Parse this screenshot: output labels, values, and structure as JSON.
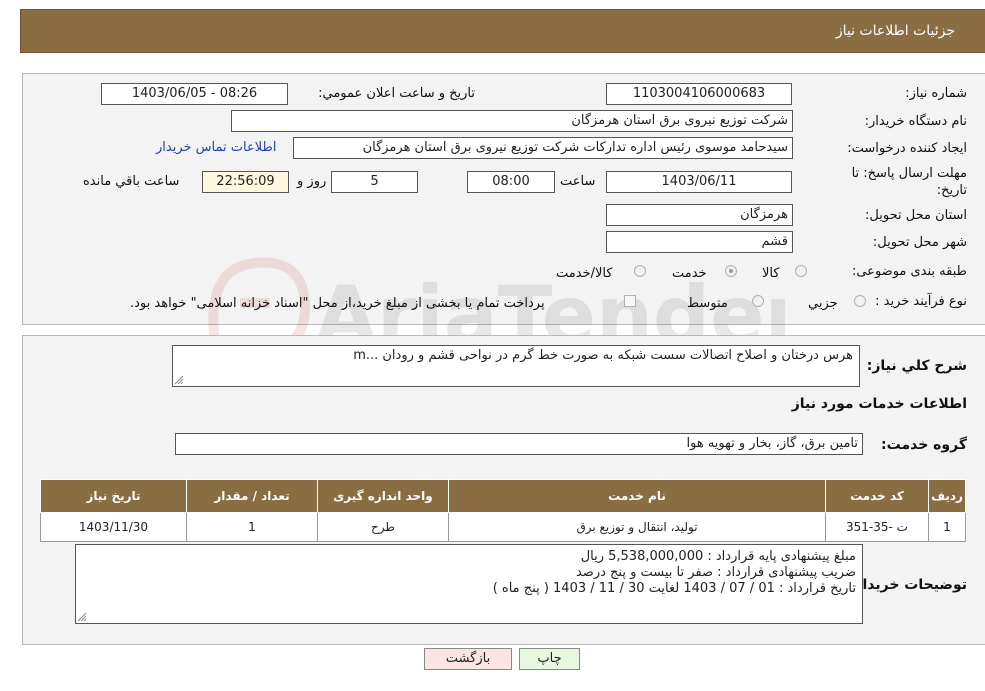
{
  "header": {
    "title": "جزئیات اطلاعات نیاز"
  },
  "fields": {
    "need_number_label": "شماره نیاز:",
    "need_number": "1103004106000683",
    "announce_label": "تاریخ و ساعت اعلان عمومي:",
    "announce_value": "1403/06/05 - 08:26",
    "buyer_org_label": "نام دستگاه خريدار:",
    "buyer_org": "شرکت توزیع نیروی برق استان هرمزگان",
    "creator_label": "ايجاد کننده درخواست:",
    "creator": "سیدحامد موسوی رئیس اداره تدارکات شرکت توزیع نیروی برق استان هرمزگان",
    "contact_link": "اطلاعات تماس خريدار",
    "deadline_label_1": "مهلت ارسال پاسخ: تا",
    "deadline_label_2": "تاریخ:",
    "deadline_date": "1403/06/11",
    "time_label": "ساعت",
    "deadline_time": "08:00",
    "days_value": "5",
    "days_label": "روز و",
    "remaining_time": "22:56:09",
    "remaining_label": "ساعت باقي مانده",
    "province_label": "استان محل تحويل:",
    "province": "هرمزگان",
    "city_label": "شهر محل تحويل:",
    "city": "قشم",
    "category_label": "طبقه بندی موضوعی:",
    "category_options": [
      "کالا",
      "خدمت",
      "کالا/خدمت"
    ],
    "category_selected": "خدمت",
    "purchase_type_label": "نوع فرآیند خرید :",
    "purchase_options": [
      "جزیي",
      "متوسط"
    ],
    "purchase_note": "پرداخت تمام یا بخشی از مبلغ خرید،از محل \"اسناد خزانه اسلامی\" خواهد بود."
  },
  "summary": {
    "label": "شرح کلي نياز:",
    "text": "هرس درختان و اصلاح اتصالات سست شبکه به صورت خط گرم در نواحی قشم و رودان ...m"
  },
  "services": {
    "section_title": "اطلاعات خدمات مورد نياز",
    "group_label": "گروه خدمت:",
    "group_value": "تامین برق، گاز، بخار و تهویه هوا",
    "columns": [
      "رديف",
      "کد خدمت",
      "نام خدمت",
      "واحد اندازه گيری",
      "تعداد / مقدار",
      "تاريخ نياز"
    ],
    "rows": [
      [
        "1",
        "ت -35-351",
        "تولید، انتقال و توزیع برق",
        "طرح",
        "1",
        "1403/11/30"
      ]
    ]
  },
  "buyer_notes": {
    "label": "توضيحات خريدار:",
    "lines": [
      "مبلغ پیشنهادی پایه قرارداد : 5,538,000,000 ریال",
      "ضریب پیشنهادی قرارداد : صفر تا بیست و پنج درصد",
      "تاریخ قرارداد : 01 / 07 / 1403 لغایت 30 / 11 / 1403 ( پنج ماه )"
    ]
  },
  "buttons": {
    "print": "چاپ",
    "back": "بازگشت"
  },
  "watermark": "AriaTender.net",
  "colors": {
    "header": "#8b6d43",
    "link": "#2241b7",
    "back_button": "#fde3e3",
    "print_button": "#e8f7e1"
  }
}
